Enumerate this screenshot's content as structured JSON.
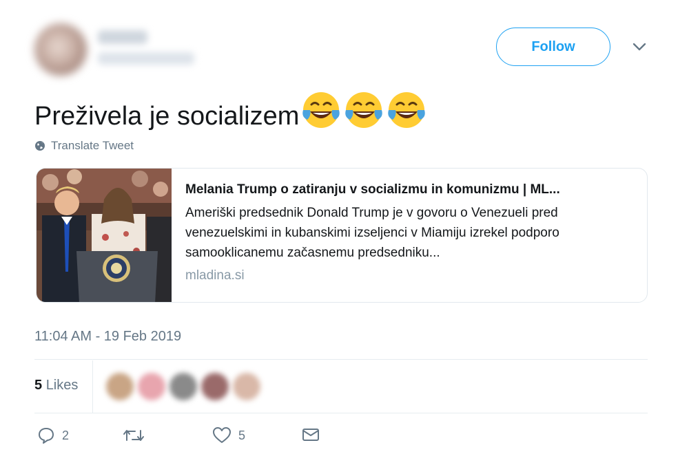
{
  "tweet": {
    "text": "Preživela je socializem",
    "emojis": [
      "😂",
      "😂",
      "😂"
    ],
    "translate_label": "Translate Tweet",
    "timestamp": "11:04 AM - 19 Feb 2019"
  },
  "header": {
    "follow_label": "Follow"
  },
  "card": {
    "title": "Melania Trump o zatiranju v socializmu in komunizmu | ML...",
    "description": "Ameriški predsednik Donald Trump je v govoru o Venezueli pred venezuelskimi in kubanskimi izseljenci v Miamiju izrekel podporo samooklicanemu začasnemu predsedniku...",
    "domain": "mladina.si"
  },
  "stats": {
    "likes_count": "5",
    "likes_label": "Likes"
  },
  "actions": {
    "reply_count": "2",
    "like_count": "5"
  },
  "colors": {
    "accent": "#1da1f2",
    "muted": "#657786",
    "text": "#14171a",
    "border": "#e1e8ed"
  }
}
